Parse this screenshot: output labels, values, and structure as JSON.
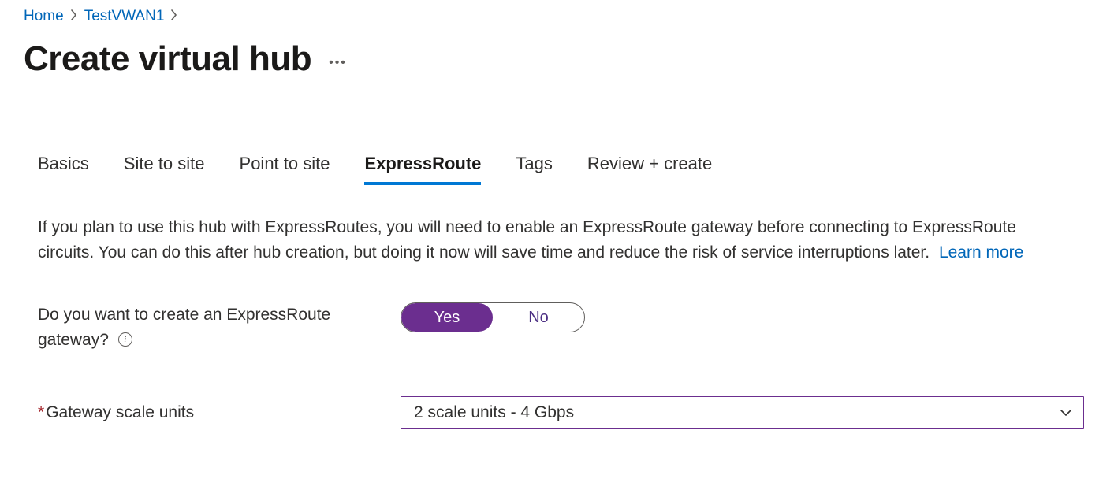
{
  "breadcrumb": {
    "home": "Home",
    "resource": "TestVWAN1"
  },
  "title": "Create virtual hub",
  "tabs": {
    "basics": "Basics",
    "site_to_site": "Site to site",
    "point_to_site": "Point to site",
    "expressroute": "ExpressRoute",
    "tags": "Tags",
    "review": "Review + create"
  },
  "description": {
    "text": "If you plan to use this hub with ExpressRoutes, you will need to enable an ExpressRoute gateway before connecting to ExpressRoute circuits. You can do this after hub creation, but doing it now will save time and reduce the risk of service interruptions later.",
    "learn_more": "Learn more"
  },
  "form": {
    "create_gateway_label": "Do you want to create an ExpressRoute gateway?",
    "toggle": {
      "yes": "Yes",
      "no": "No"
    },
    "scale_units_label": "Gateway scale units",
    "scale_units_value": "2 scale units - 4 Gbps"
  }
}
